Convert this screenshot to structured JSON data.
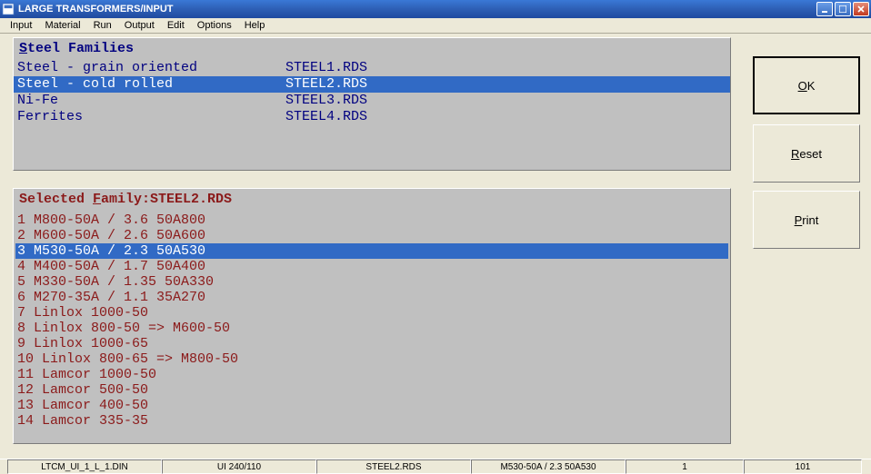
{
  "window": {
    "title": "LARGE TRANSFORMERS/INPUT"
  },
  "menu": {
    "items": [
      "Input",
      "Material",
      "Run",
      "Output",
      "Edit",
      "Options",
      "Help"
    ]
  },
  "families_panel": {
    "header_prefix": "S",
    "header_rest": "teel Families",
    "rows": [
      {
        "name": "Steel - grain oriented",
        "file": "STEEL1.RDS",
        "selected": false
      },
      {
        "name": "Steel - cold rolled",
        "file": "STEEL2.RDS",
        "selected": true
      },
      {
        "name": "Ni-Fe",
        "file": "STEEL3.RDS",
        "selected": false
      },
      {
        "name": "Ferrites",
        "file": "STEEL4.RDS",
        "selected": false
      }
    ]
  },
  "selected_panel": {
    "header_label": "Selected ",
    "header_prefix": "F",
    "header_rest": "amily:",
    "header_file": "STEEL2.RDS",
    "rows": [
      {
        "text": "1 M800-50A / 3.6 50A800",
        "selected": false
      },
      {
        "text": "2 M600-50A / 2.6 50A600",
        "selected": false
      },
      {
        "text": "3 M530-50A / 2.3 50A530",
        "selected": true
      },
      {
        "text": "4 M400-50A / 1.7 50A400",
        "selected": false
      },
      {
        "text": "5 M330-50A / 1.35 50A330",
        "selected": false
      },
      {
        "text": "6 M270-35A / 1.1 35A270",
        "selected": false
      },
      {
        "text": "7 Linlox 1000-50",
        "selected": false
      },
      {
        "text": "8 Linlox 800-50 => M600-50",
        "selected": false
      },
      {
        "text": "9 Linlox 1000-65",
        "selected": false
      },
      {
        "text": "10 Linlox 800-65 => M800-50",
        "selected": false
      },
      {
        "text": "11 Lamcor 1000-50",
        "selected": false
      },
      {
        "text": "12 Lamcor 500-50",
        "selected": false
      },
      {
        "text": "13 Lamcor 400-50",
        "selected": false
      },
      {
        "text": "14 Lamcor 335-35",
        "selected": false
      }
    ]
  },
  "buttons": {
    "ok_prefix": "O",
    "ok_rest": "K",
    "reset_prefix": "R",
    "reset_rest": "eset",
    "print_prefix": "P",
    "print_rest": "rint"
  },
  "statusbar": {
    "cells": [
      "LTCM_UI_1_L_1.DIN",
      "UI 240/110",
      "STEEL2.RDS",
      "M530-50A / 2.3 50A530",
      "1",
      "101"
    ]
  }
}
